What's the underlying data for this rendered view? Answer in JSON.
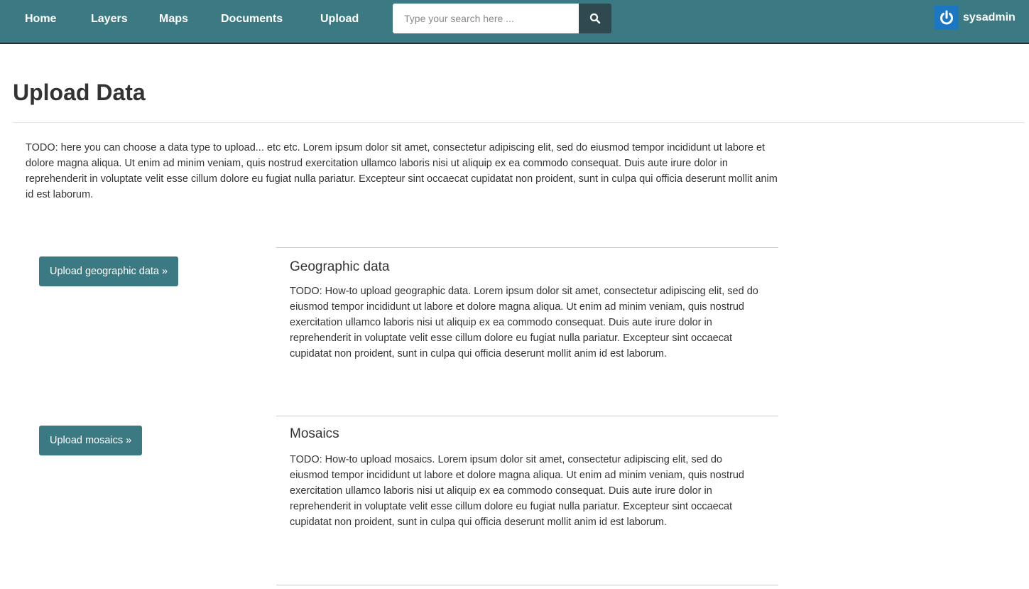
{
  "nav": {
    "items": [
      {
        "label": "Home"
      },
      {
        "label": "Layers"
      },
      {
        "label": "Maps"
      },
      {
        "label": "Documents"
      },
      {
        "label": "Upload"
      }
    ],
    "search": {
      "placeholder": "Type your search here ...",
      "button_icon": "search-icon"
    },
    "user": {
      "name": "sysadmin",
      "icon": "power-icon"
    }
  },
  "page": {
    "title": "Upload Data",
    "intro": "TODO: here you can choose a data type to upload... etc etc. Lorem ipsum dolor sit amet, consectetur adipiscing elit, sed do eiusmod tempor incididunt ut labore et dolore magna aliqua. Ut enim ad minim veniam, quis nostrud exercitation ullamco laboris nisi ut aliquip ex ea commodo consequat. Duis aute irure dolor in reprehenderit in voluptate velit esse cillum dolore eu fugiat nulla pariatur. Excepteur sint occaecat cupidatat non proident, sunt in culpa qui officia deserunt mollit anim id est laborum."
  },
  "sections": [
    {
      "button_label": "Upload geographic data »",
      "title": "Geographic data",
      "body": "TODO: How-to upload geographic data. Lorem ipsum dolor sit amet, consectetur adipiscing elit, sed do eiusmod tempor incididunt ut labore et dolore magna aliqua. Ut enim ad minim veniam, quis nostrud exercitation ullamco laboris nisi ut aliquip ex ea commodo consequat. Duis aute irure dolor in reprehenderit in voluptate velit esse cillum dolore eu fugiat nulla pariatur. Excepteur sint occaecat cupidatat non proident, sunt in culpa qui officia deserunt mollit anim id est laborum."
    },
    {
      "button_label": "Upload mosaics »",
      "title": "Mosaics",
      "body": "TODO: How-to upload mosaics. Lorem ipsum dolor sit amet, consectetur adipiscing elit, sed do eiusmod tempor incididunt ut labore et dolore magna aliqua. Ut enim ad minim veniam, quis nostrud exercitation ullamco laboris nisi ut aliquip ex ea commodo consequat. Duis aute irure dolor in reprehenderit in voluptate velit esse cillum dolore eu fugiat nulla pariatur. Excepteur sint occaecat cupidatat non proident, sunt in culpa qui officia deserunt mollit anim id est laborum."
    }
  ],
  "colors": {
    "navbar": "#3b7a82",
    "search_button": "#2e4a50",
    "user_avatar": "#1c77c3",
    "action_button": "#3b7a82"
  }
}
